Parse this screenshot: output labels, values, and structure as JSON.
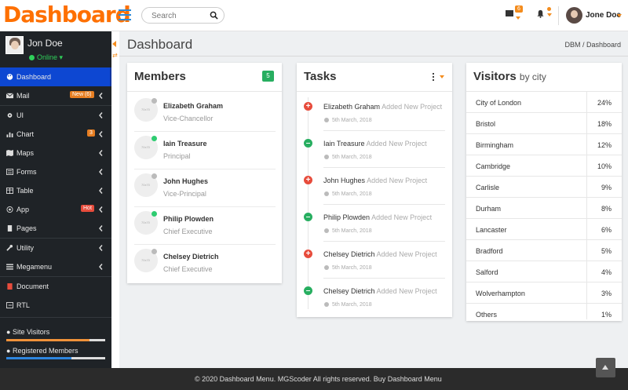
{
  "app": {
    "logo": "Dashboard"
  },
  "topbar": {
    "search_placeholder": "Search",
    "mail_count": "6",
    "user_name": "Jone Doe"
  },
  "sidebar": {
    "user_name": "Jon Doe",
    "status": "Online",
    "items": [
      {
        "label": "Dashboard",
        "icon": "palette-icon"
      },
      {
        "label": "Mail",
        "icon": "mail-icon",
        "badge": "New (6)"
      },
      {
        "label": "UI",
        "icon": "gear-icon"
      },
      {
        "label": "Chart",
        "icon": "chart-icon",
        "badge": "3"
      },
      {
        "label": "Maps",
        "icon": "map-icon"
      },
      {
        "label": "Forms",
        "icon": "form-icon"
      },
      {
        "label": "Table",
        "icon": "table-icon"
      },
      {
        "label": "App",
        "icon": "app-icon",
        "badge": "Hot"
      },
      {
        "label": "Pages",
        "icon": "page-icon"
      },
      {
        "label": "Utility",
        "icon": "wrench-icon"
      },
      {
        "label": "Megamenu",
        "icon": "menu-icon"
      },
      {
        "label": "Document",
        "icon": "book-icon"
      },
      {
        "label": "RTL",
        "icon": "rtl-icon"
      }
    ],
    "progress": [
      {
        "label": "Site Visitors",
        "level": 0.84
      },
      {
        "label": "Registered Members",
        "level": 0.66
      }
    ]
  },
  "page": {
    "title": "Dashboard",
    "breadcrumb": "DBM / Dashboard"
  },
  "members": {
    "title": "Members",
    "count": "5",
    "avatar_placeholder": "70x70",
    "list": [
      {
        "name": "Elizabeth Graham",
        "role": "Vice-Chancellor",
        "status": "offline"
      },
      {
        "name": "Iain Treasure",
        "role": "Principal",
        "status": "online"
      },
      {
        "name": "John Hughes",
        "role": "Vice-Principal",
        "status": "offline"
      },
      {
        "name": "Philip Plowden",
        "role": "Chief Executive",
        "status": "online"
      },
      {
        "name": "Chelsey Dietrich",
        "role": "Chief Executive",
        "status": "offline"
      }
    ]
  },
  "tasks": {
    "title": "Tasks",
    "list": [
      {
        "name": "Elizabeth Graham",
        "action": "Added New Project",
        "date": "5th March, 2018",
        "mark": "plus"
      },
      {
        "name": "Iain Treasure",
        "action": "Added New Project",
        "date": "5th March, 2018",
        "mark": "minus"
      },
      {
        "name": "John Hughes",
        "action": "Added New Project",
        "date": "5th March, 2018",
        "mark": "plus"
      },
      {
        "name": "Philip Plowden",
        "action": "Added New Project",
        "date": "5th March, 2018",
        "mark": "minus"
      },
      {
        "name": "Chelsey Dietrich",
        "action": "Added New Project",
        "date": "5th March, 2018",
        "mark": "plus"
      },
      {
        "name": "Chelsey Dietrich",
        "action": "Added New Project",
        "date": "5th March, 2018",
        "mark": "minus"
      }
    ]
  },
  "visitors": {
    "title": "Visitors",
    "subtitle": "by city",
    "rows": [
      {
        "city": "City of London",
        "pct": "24%"
      },
      {
        "city": "Bristol",
        "pct": "18%"
      },
      {
        "city": "Birmingham",
        "pct": "12%"
      },
      {
        "city": "Cambridge",
        "pct": "10%"
      },
      {
        "city": "Carlisle",
        "pct": "9%"
      },
      {
        "city": "Durham",
        "pct": "8%"
      },
      {
        "city": "Lancaster",
        "pct": "6%"
      },
      {
        "city": "Bradford",
        "pct": "5%"
      },
      {
        "city": "Salford",
        "pct": "4%"
      },
      {
        "city": "Wolverhampton",
        "pct": "3%"
      },
      {
        "city": "Others",
        "pct": "1%"
      }
    ]
  },
  "footer": {
    "text": "© 2020 Dashboard Menu. MGScoder All rights reserved. Buy Dashboard Menu"
  },
  "colors": {
    "brand": "#fe7000",
    "accent": "#f48c1d",
    "active": "#0d47d2",
    "success": "#27ae60",
    "danger": "#e74c3c",
    "online": "#2ecc71"
  }
}
